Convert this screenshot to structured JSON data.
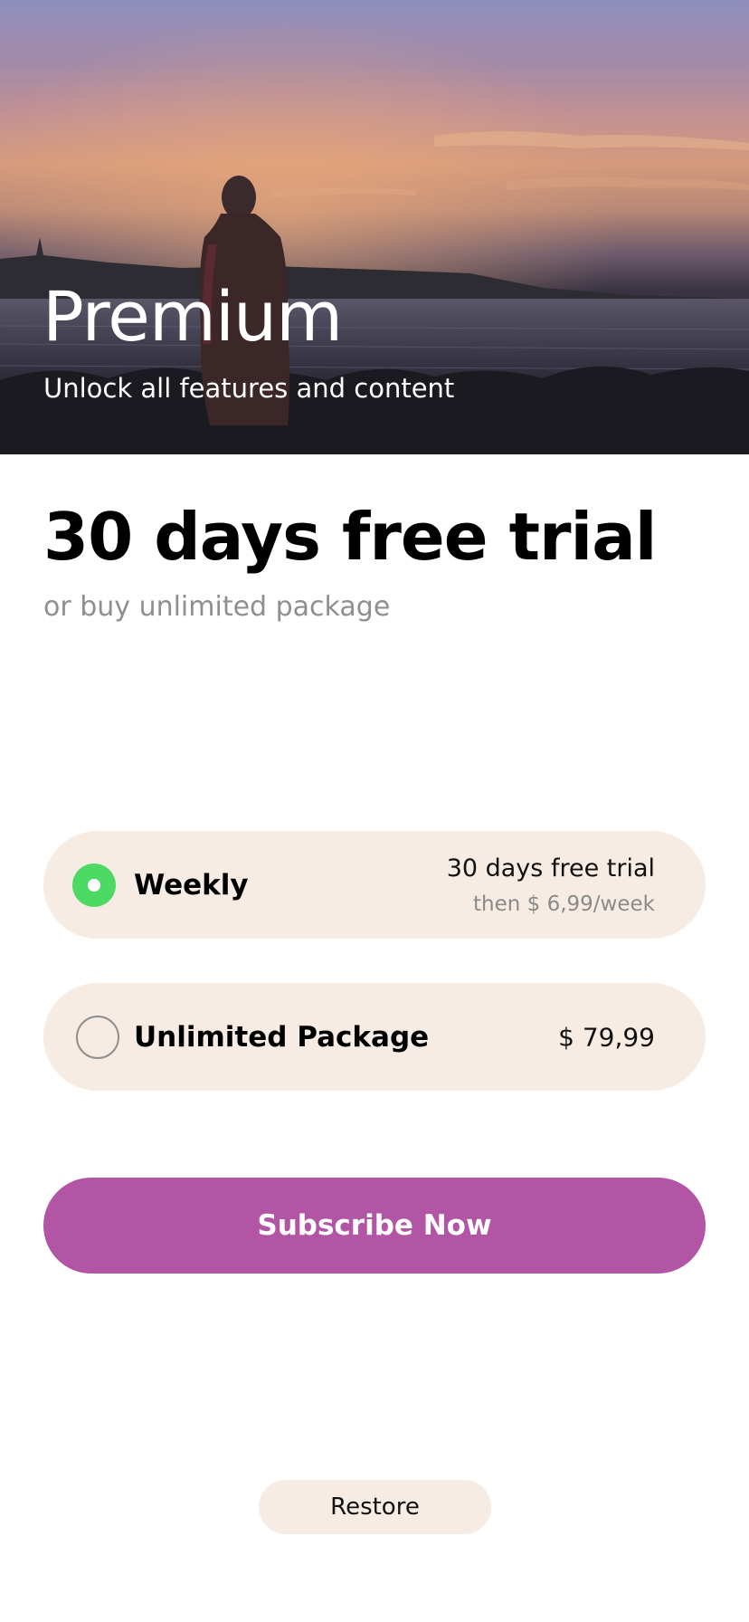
{
  "hero": {
    "title": "Premium",
    "subtitle": "Unlock all features and content"
  },
  "offer": {
    "title": "30 days free trial",
    "subtitle": "or buy unlimited package"
  },
  "plans": [
    {
      "name": "Weekly",
      "trial": "30 days free trial",
      "then": "then $ 6,99/week",
      "selected": true
    },
    {
      "name": "Unlimited Package",
      "price": "$ 79,99",
      "selected": false
    }
  ],
  "actions": {
    "subscribe_label": "Subscribe Now",
    "restore_label": "Restore"
  },
  "colors": {
    "accent": "#b255a4",
    "selected_radio": "#4cd964",
    "option_background": "#f6ece3",
    "muted_text": "#8f8f8f"
  }
}
